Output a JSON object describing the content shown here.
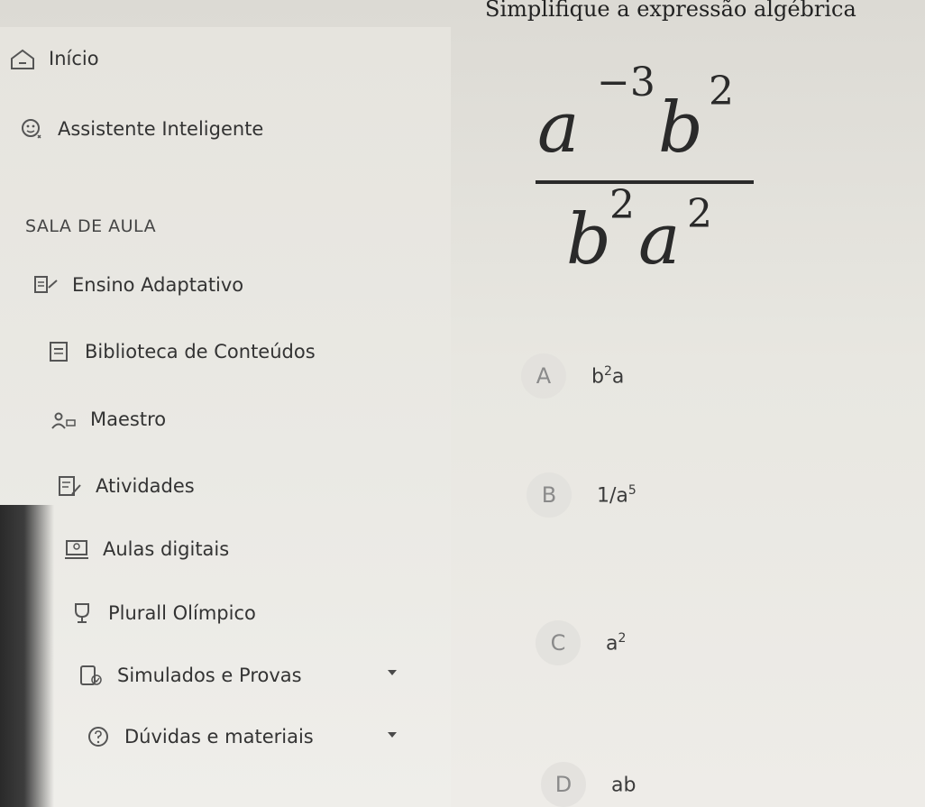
{
  "sidebar": {
    "items": [
      {
        "label": "Início",
        "icon": "home-icon"
      },
      {
        "label": "Assistente Inteligente",
        "icon": "assistant-icon"
      },
      {
        "label": "Ensino Adaptativo",
        "icon": "adaptive-learning-icon"
      },
      {
        "label": "Biblioteca de Conteúdos",
        "icon": "library-icon"
      },
      {
        "label": "Maestro",
        "icon": "maestro-icon"
      },
      {
        "label": "Atividades",
        "icon": "activities-icon"
      },
      {
        "label": "Aulas digitais",
        "icon": "digital-class-icon"
      },
      {
        "label": "Plurall Olímpico",
        "icon": "trophy-icon"
      },
      {
        "label": "Simulados e Provas",
        "icon": "exam-icon"
      },
      {
        "label": "Dúvidas e materiais",
        "icon": "help-icon"
      }
    ],
    "section_label": "SALA DE AULA"
  },
  "question": {
    "title": "Simplifique a expressão algébrica",
    "expression": {
      "numerator": {
        "base1": "a",
        "exp1": "−3",
        "base2": "b",
        "exp2": "2"
      },
      "denominator": {
        "base1": "b",
        "exp1": "2",
        "base2": "a",
        "exp2": "2"
      }
    },
    "options": [
      {
        "letter": "A",
        "base": "b",
        "sup": "2",
        "tail": "a"
      },
      {
        "letter": "B",
        "base": "1/a",
        "sup": "5",
        "tail": ""
      },
      {
        "letter": "C",
        "base": "a",
        "sup": "2",
        "tail": ""
      },
      {
        "letter": "D",
        "base": "ab",
        "sup": "",
        "tail": ""
      }
    ]
  }
}
